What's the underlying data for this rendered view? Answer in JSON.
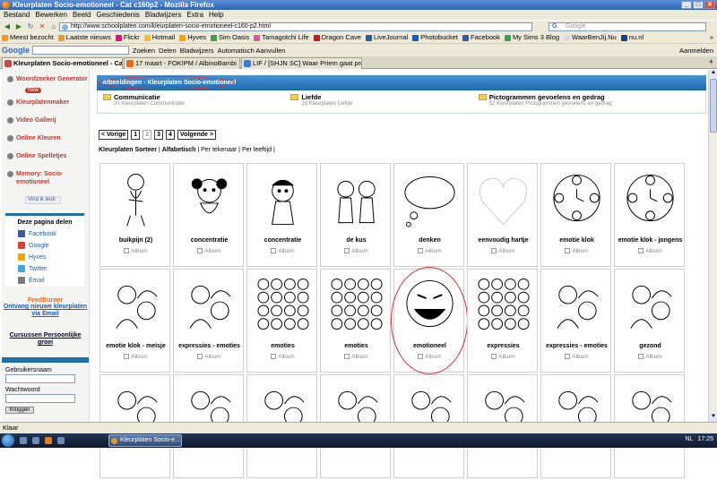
{
  "window": {
    "title": "Kleurplaten Socio-emotioneel - Cat c160p2 - Mozilla Firefox"
  },
  "menu": [
    "Bestand",
    "Bewerken",
    "Beeld",
    "Geschiedenis",
    "Bladwijzers",
    "Extra",
    "Help"
  ],
  "nav": {
    "url": "http://www.schoolplaten.com/kleurplaten-socio-emotioneel-c160-p2.html",
    "search_placeholder": "Google"
  },
  "bookmarks": [
    "Meest bezocht",
    "Laatste nieuws",
    "Flickr",
    "Hotmail",
    "Hyves",
    "Sim Oasis",
    "Tamagotchi Life",
    "Dragon Cave",
    "LiveJournal",
    "Photobucket",
    "Facebook",
    "My Sims 3 Blog",
    "WaarBenJij.Nu",
    "nu.nl"
  ],
  "bookmarks_right": "»",
  "googlebar": {
    "logo": "Google",
    "items": [
      "Zoeken",
      "Delen",
      "Bladwijzers",
      "Automatisch Aanvullen"
    ],
    "right": "Aanmelden"
  },
  "tabs": [
    {
      "label": "Kleurplaten Socio-emotioneel - Cat ...",
      "active": true
    },
    {
      "label": "17 maart - FOK!PM / AlbinoBambi",
      "active": false
    },
    {
      "label": "LIF / [SHJN SC] Waar Priem gaat prob...",
      "active": false
    }
  ],
  "sidebar": {
    "nav": [
      "Woordzoeker Generator",
      "Kleurplatenmaker",
      "Video Gallerij",
      "Online Kleuren",
      "Online Spelletjes",
      "Memory: Socio-emotioneel"
    ],
    "new_badge": "New",
    "fb_like": "Vind ik leuk",
    "share_heading": "Deze pagina delen",
    "share": [
      {
        "label": "Facebook",
        "color": "#3b5998"
      },
      {
        "label": "Google",
        "color": "#d8432e"
      },
      {
        "label": "Hyves",
        "color": "#f0a30a"
      },
      {
        "label": "Twitter",
        "color": "#3fa9e0"
      },
      {
        "label": "Email",
        "color": "#7a7a7a"
      }
    ],
    "feedburner": "FeedBurner",
    "feed_link": "Ontvang nieuwe kleurplaten via Email",
    "courses": "Cursussen Persoonlijke groei",
    "username_label": "Gebruikersnaam",
    "password_label": "Wachtwoord",
    "login_button": "Inloggen"
  },
  "breadcrumb": "Afbeeldingen - Kleurplaten Socio-emotioneel",
  "categories": [
    {
      "name": "Communicatie",
      "count": "20 Kleurplaten Communicatie"
    },
    {
      "name": "Liefde",
      "count": "33 Kleurplaten Liefde"
    },
    {
      "name": "Pictogrammen gevoelens en gedrag",
      "count": "52 Kleurplaten Pictogrammen gevoelens en gedrag"
    }
  ],
  "pager": {
    "prev": "< Vorige",
    "pages": [
      "1",
      "2",
      "3",
      "4"
    ],
    "current": "2",
    "next": "Volgende >"
  },
  "sort": {
    "prefix": "Kleurplaten Sorteer",
    "options": [
      "Alfabetisch",
      "Per tekenaar",
      "Per leeftijd"
    ]
  },
  "album_label": "Album",
  "cards": [
    {
      "label": "buikpijn (2)"
    },
    {
      "label": "concentratie"
    },
    {
      "label": "concentratie"
    },
    {
      "label": "de kus"
    },
    {
      "label": "denken"
    },
    {
      "label": "eenvoudig hartje"
    },
    {
      "label": "emotie klok"
    },
    {
      "label": "emotie klok - jongens"
    },
    {
      "label": "emotie klok - meisje"
    },
    {
      "label": "expressies - emoties"
    },
    {
      "label": "emoties"
    },
    {
      "label": "emoties"
    },
    {
      "label": "emotioneel",
      "highlight": true
    },
    {
      "label": "expressies"
    },
    {
      "label": "expressies - emoties"
    },
    {
      "label": "gezond"
    },
    {
      "label": ""
    },
    {
      "label": ""
    },
    {
      "label": ""
    },
    {
      "label": ""
    },
    {
      "label": ""
    },
    {
      "label": ""
    },
    {
      "label": ""
    },
    {
      "label": ""
    }
  ],
  "status": "Klaar",
  "taskbar": {
    "task": "Kleurplaten Socio-e...",
    "lang": "NL",
    "time": "17:25"
  }
}
